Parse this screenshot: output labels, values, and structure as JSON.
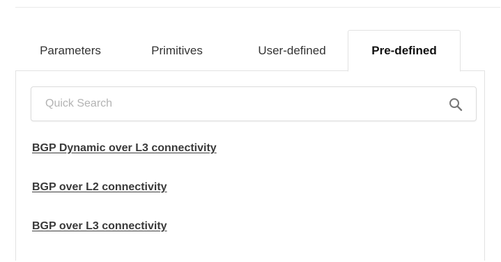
{
  "tabs": [
    {
      "label": "Parameters",
      "active": false
    },
    {
      "label": "Primitives",
      "active": false
    },
    {
      "label": "User-defined",
      "active": false
    },
    {
      "label": "Pre-defined",
      "active": true
    }
  ],
  "search": {
    "placeholder": "Quick Search",
    "value": "",
    "icon": "search-icon"
  },
  "templates": [
    {
      "label": "BGP Dynamic over L3 connectivity"
    },
    {
      "label": "BGP over L2 connectivity"
    },
    {
      "label": "BGP over L3 connectivity"
    }
  ],
  "colors": {
    "text": "#333333",
    "border": "#e2e2e2",
    "placeholder": "#b3b3b3"
  }
}
